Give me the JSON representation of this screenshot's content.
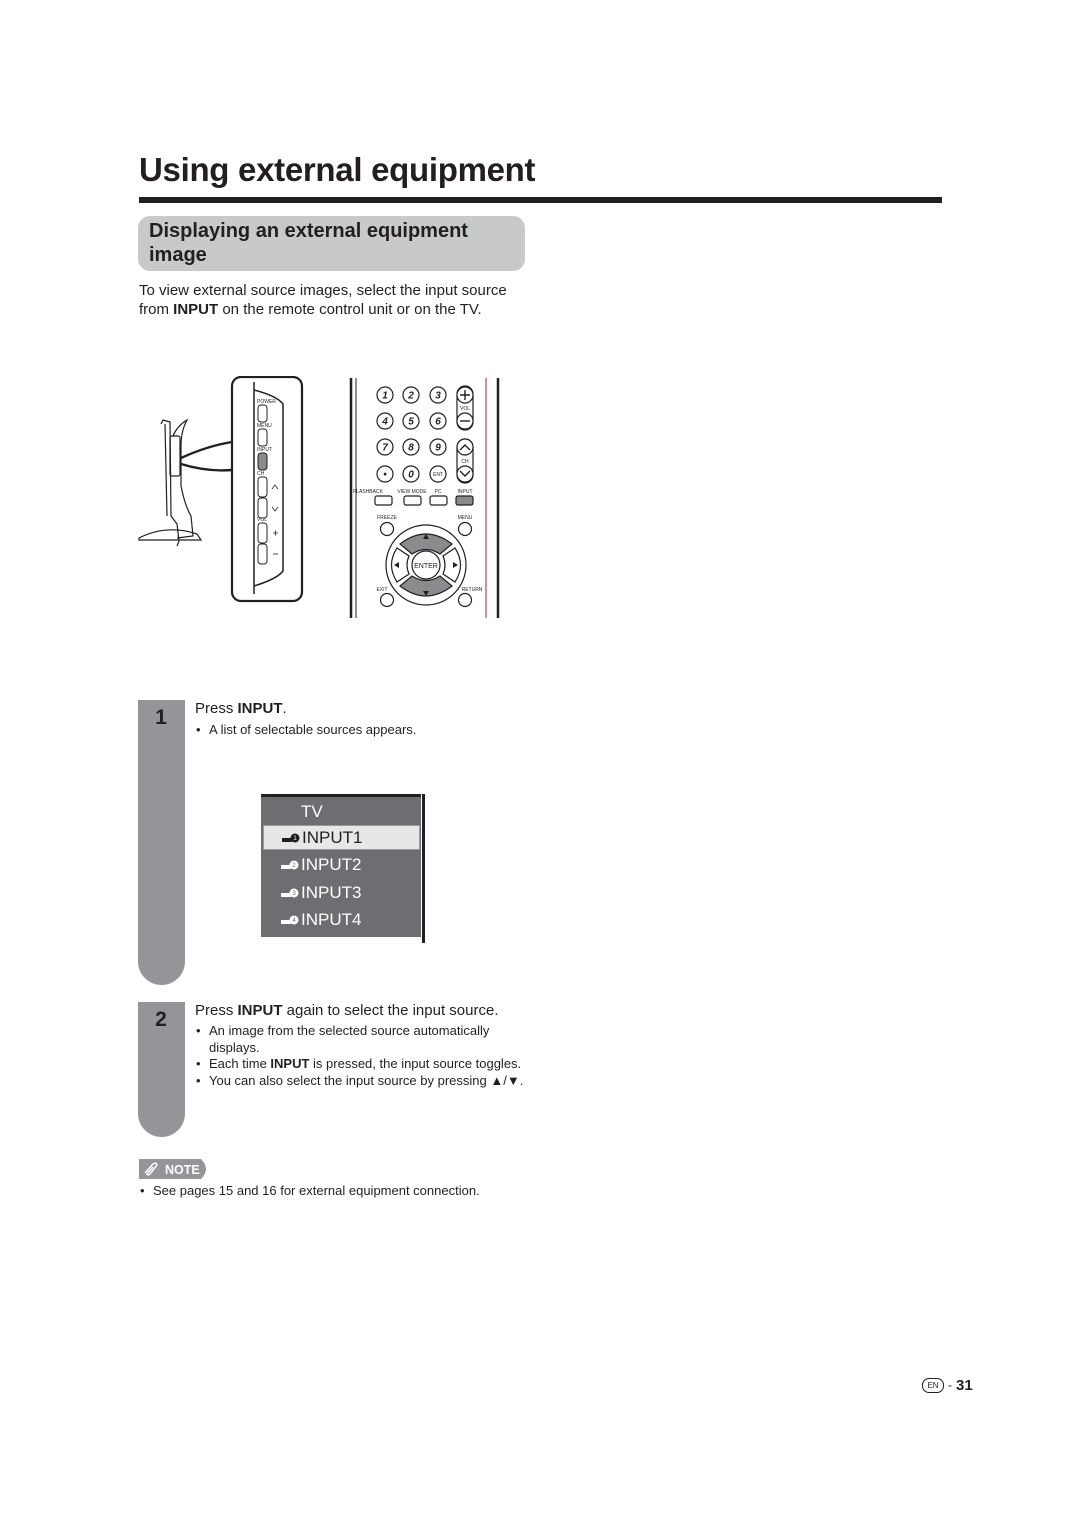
{
  "page": {
    "title": "Using external equipment",
    "section_title": "Displaying an external equipment image",
    "intro": {
      "before": "To view external source images, select the input source from ",
      "bold": "INPUT",
      "after": " on the remote control unit or on the TV."
    }
  },
  "tv_panel": {
    "buttons": [
      "POWER",
      "MENU",
      "INPUT",
      "CH",
      "",
      "VOL",
      ""
    ],
    "side_symbols": [
      "^",
      "v",
      "+",
      "−"
    ],
    "highlighted": "INPUT"
  },
  "remote": {
    "number_keys": [
      "1",
      "2",
      "3",
      "4",
      "5",
      "6",
      "7",
      "8",
      "9",
      "•",
      "0",
      "ENT"
    ],
    "vol_label": "VOL",
    "ch_label": "CH",
    "function_keys": [
      "FLASHBACK",
      "VIEW MODE",
      "PC",
      "INPUT"
    ],
    "freeze_label": "FREEZE",
    "menu_label": "MENU",
    "enter_label": "ENTER",
    "exit_label": "EXIT",
    "return_label": "RETURN",
    "highlighted": "INPUT"
  },
  "steps": [
    {
      "number": "1",
      "head_before": "Press ",
      "head_bold": "INPUT",
      "head_after": ".",
      "bullets": [
        {
          "before": "A list of selectable sources appears.",
          "bold": "",
          "after": ""
        }
      ]
    },
    {
      "number": "2",
      "head_before": "Press ",
      "head_bold": "INPUT",
      "head_after": " again to select the input source.",
      "bullets": [
        {
          "before": "An image from the selected source automatically displays.",
          "bold": "",
          "after": ""
        },
        {
          "before": "Each time ",
          "bold": "INPUT",
          "after": " is pressed, the input source toggles."
        },
        {
          "before": "You can also select the input source by pressing ▲/▼.",
          "bold": "",
          "after": ""
        }
      ]
    }
  ],
  "input_menu": {
    "items": [
      {
        "label": "TV",
        "icon": "",
        "selected": false
      },
      {
        "label": "INPUT1",
        "icon": "plug-1-icon",
        "badge": "1",
        "selected": true
      },
      {
        "label": "INPUT2",
        "icon": "plug-2-icon",
        "badge": "2",
        "selected": false
      },
      {
        "label": "INPUT3",
        "icon": "plug-3-icon",
        "badge": "3",
        "selected": false
      },
      {
        "label": "INPUT4",
        "icon": "plug-4-icon",
        "badge": "4",
        "selected": false
      }
    ]
  },
  "note": {
    "badge": "NOTE",
    "text": "See pages 15 and 16 for external equipment connection."
  },
  "footer": {
    "lang": "EN",
    "separator": "-",
    "page_number": "31"
  }
}
